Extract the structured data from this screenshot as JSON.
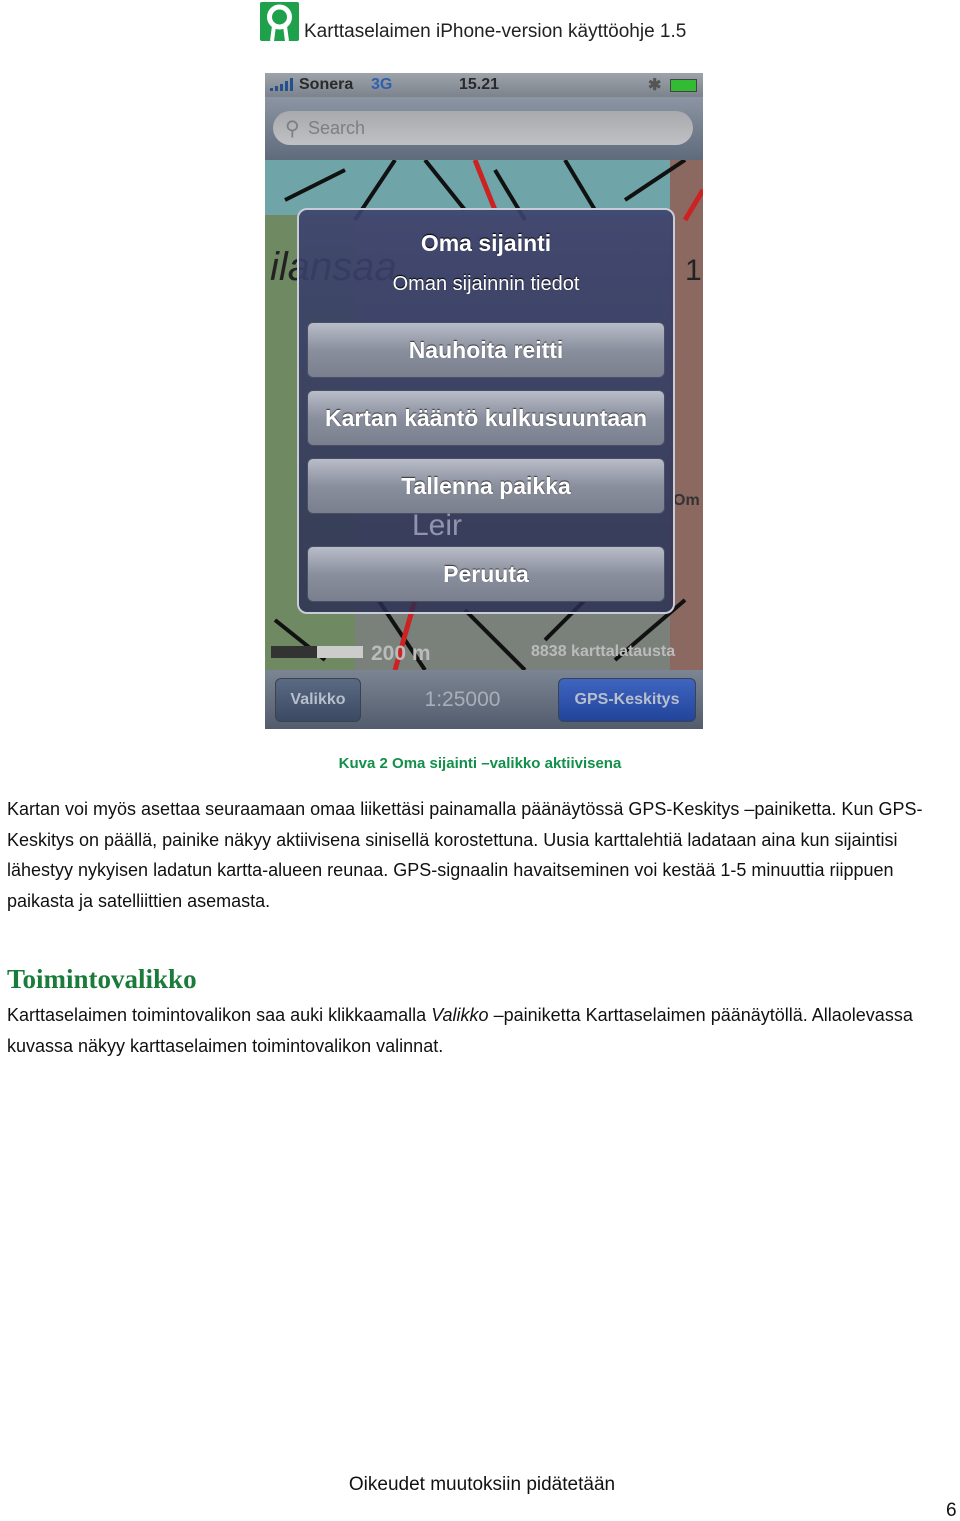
{
  "header": {
    "title": "Karttaselaimen iPhone-version käyttöohje 1.5"
  },
  "phone": {
    "status": {
      "carrier": "Sonera",
      "network": "3G",
      "time": "15.21",
      "icons": [
        "signal-icon",
        "bluetooth-icon",
        "battery-icon"
      ]
    },
    "search": {
      "placeholder": "Search"
    },
    "dialog": {
      "title": "Oma sijainti",
      "subtitle": "Oman sijainnin tiedot",
      "buttons": [
        "Nauhoita reitti",
        "Kartan kääntö kulkusuuntaan",
        "Tallenna paikka",
        "Peruuta"
      ]
    },
    "map": {
      "scale_label": "200 m",
      "tiles_label": "8838 karttalatausta",
      "labels": [
        "ilansaa",
        "Leir",
        "Om",
        "1"
      ]
    },
    "toolbar": {
      "menu": "Valikko",
      "scale": "1:25000",
      "gps": "GPS-Keskitys",
      "gps_active_color": "#2a4fa8"
    }
  },
  "caption": "Kuva 2 Oma sijainti –valikko aktiivisena",
  "paragraph1": "Kartan voi myös asettaa seuraamaan omaa liikettäsi painamalla päänäytössä GPS-Keskitys –painiketta. Kun GPS-Keskitys on päällä, painike näkyy aktiivisena sinisellä korostettuna. Uusia karttalehtiä ladataan aina kun sijaintisi lähestyy nykyisen ladatun kartta-alueen reunaa. GPS-signaalin havaitseminen voi kestää 1-5 minuuttia riippuen paikasta ja satelliittien asemasta.",
  "heading": "Toimintovalikko",
  "paragraph2": {
    "before": "Karttaselaimen toimintovalikon saa auki klikkaamalla ",
    "em": "Valikko",
    "after": " –painiketta Karttaselaimen päänäytöllä. Allaolevassa kuvassa näkyy karttaselaimen toimintovalikon valinnat."
  },
  "footer": "Oikeudet muutoksiin pidätetään",
  "page_number": "6"
}
